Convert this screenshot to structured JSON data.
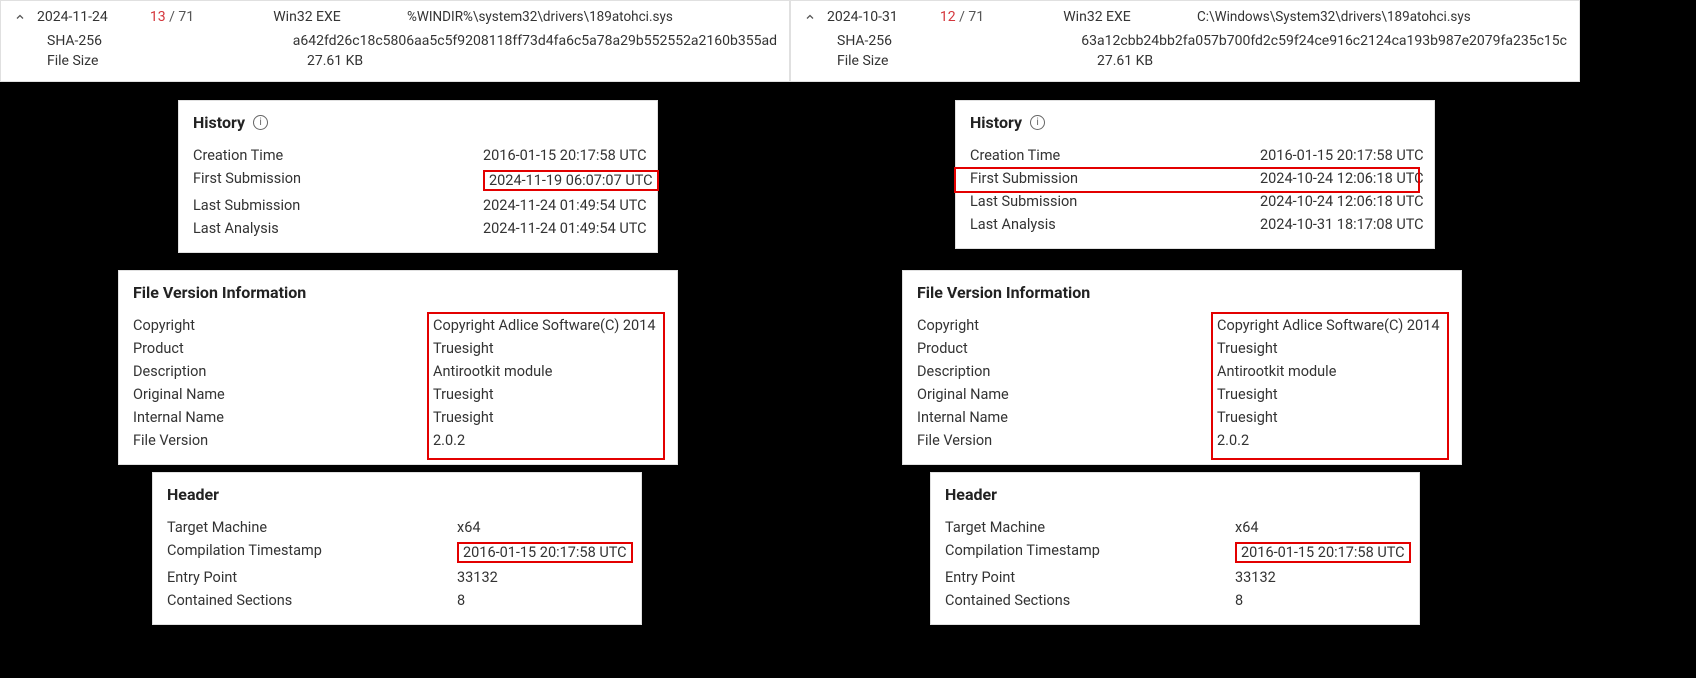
{
  "left": {
    "top": {
      "date": "2024-11-24",
      "detections": "13",
      "total": "71",
      "type": "Win32 EXE",
      "path": "%WINDIR%\\system32\\drivers\\189atohci.sys",
      "sha256_label": "SHA-256",
      "sha256": "a642fd26c18c5806aa5c5f9208118ff73d4fa6c5a78a29b552552a2160b355ad",
      "size_label": "File Size",
      "size": "27.61 KB"
    },
    "history": {
      "title": "History",
      "rows": [
        {
          "label": "Creation Time",
          "value": "2016-01-15 20:17:58 UTC"
        },
        {
          "label": "First Submission",
          "value": "2024-11-19 06:07:07 UTC"
        },
        {
          "label": "Last Submission",
          "value": "2024-11-24 01:49:54 UTC"
        },
        {
          "label": "Last Analysis",
          "value": "2024-11-24 01:49:54 UTC"
        }
      ]
    },
    "fvi": {
      "title": "File Version Information",
      "rows": [
        {
          "label": "Copyright",
          "value": "Copyright Adlice Software(C) 2014"
        },
        {
          "label": "Product",
          "value": "Truesight"
        },
        {
          "label": "Description",
          "value": "Antirootkit module"
        },
        {
          "label": "Original Name",
          "value": "Truesight"
        },
        {
          "label": "Internal Name",
          "value": "Truesight"
        },
        {
          "label": "File Version",
          "value": "2.0.2"
        }
      ]
    },
    "header": {
      "title": "Header",
      "rows": [
        {
          "label": "Target Machine",
          "value": "x64"
        },
        {
          "label": "Compilation Timestamp",
          "value": "2016-01-15 20:17:58 UTC"
        },
        {
          "label": "Entry Point",
          "value": "33132"
        },
        {
          "label": "Contained Sections",
          "value": "8"
        }
      ]
    }
  },
  "right": {
    "top": {
      "date": "2024-10-31",
      "detections": "12",
      "total": "71",
      "type": "Win32 EXE",
      "path": "C:\\Windows\\System32\\drivers\\189atohci.sys",
      "sha256_label": "SHA-256",
      "sha256": "63a12cbb24bb2fa057b700fd2c59f24ce916c2124ca193b987e2079fa235c15c",
      "size_label": "File Size",
      "size": "27.61 KB"
    },
    "history": {
      "title": "History",
      "rows": [
        {
          "label": "Creation Time",
          "value": "2016-01-15 20:17:58 UTC"
        },
        {
          "label": "First Submission",
          "value": "2024-10-24 12:06:18 UTC"
        },
        {
          "label": "Last Submission",
          "value": "2024-10-24 12:06:18 UTC"
        },
        {
          "label": "Last Analysis",
          "value": "2024-10-31 18:17:08 UTC"
        }
      ]
    },
    "fvi": {
      "title": "File Version Information",
      "rows": [
        {
          "label": "Copyright",
          "value": "Copyright Adlice Software(C) 2014"
        },
        {
          "label": "Product",
          "value": "Truesight"
        },
        {
          "label": "Description",
          "value": "Antirootkit module"
        },
        {
          "label": "Original Name",
          "value": "Truesight"
        },
        {
          "label": "Internal Name",
          "value": "Truesight"
        },
        {
          "label": "File Version",
          "value": "2.0.2"
        }
      ]
    },
    "header": {
      "title": "Header",
      "rows": [
        {
          "label": "Target Machine",
          "value": "x64"
        },
        {
          "label": "Compilation Timestamp",
          "value": "2016-01-15 20:17:58 UTC"
        },
        {
          "label": "Entry Point",
          "value": "33132"
        },
        {
          "label": "Contained Sections",
          "value": "8"
        }
      ]
    }
  }
}
